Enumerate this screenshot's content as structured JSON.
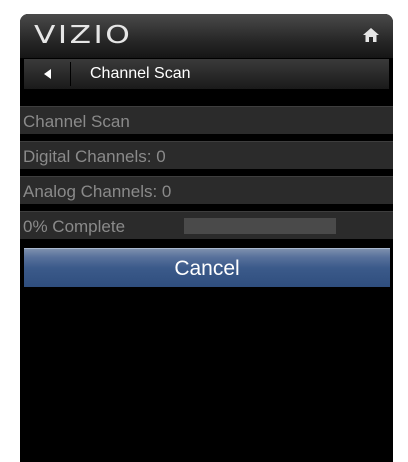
{
  "header": {
    "brand": "VIZIO",
    "icon": "home-icon"
  },
  "breadcrumb": {
    "back_icon": "back-arrow-icon",
    "label": "Channel Scan"
  },
  "scan": {
    "title": "Channel Scan",
    "digital_label": "Digital Channels: 0",
    "analog_label": "Analog Channels: 0",
    "progress_label": "0% Complete",
    "progress_fraction": 0.0
  },
  "actions": {
    "cancel_label": "Cancel"
  },
  "colors": {
    "accent": "#3b5a8a",
    "background": "#000000",
    "row_text": "#8a8a8a"
  }
}
